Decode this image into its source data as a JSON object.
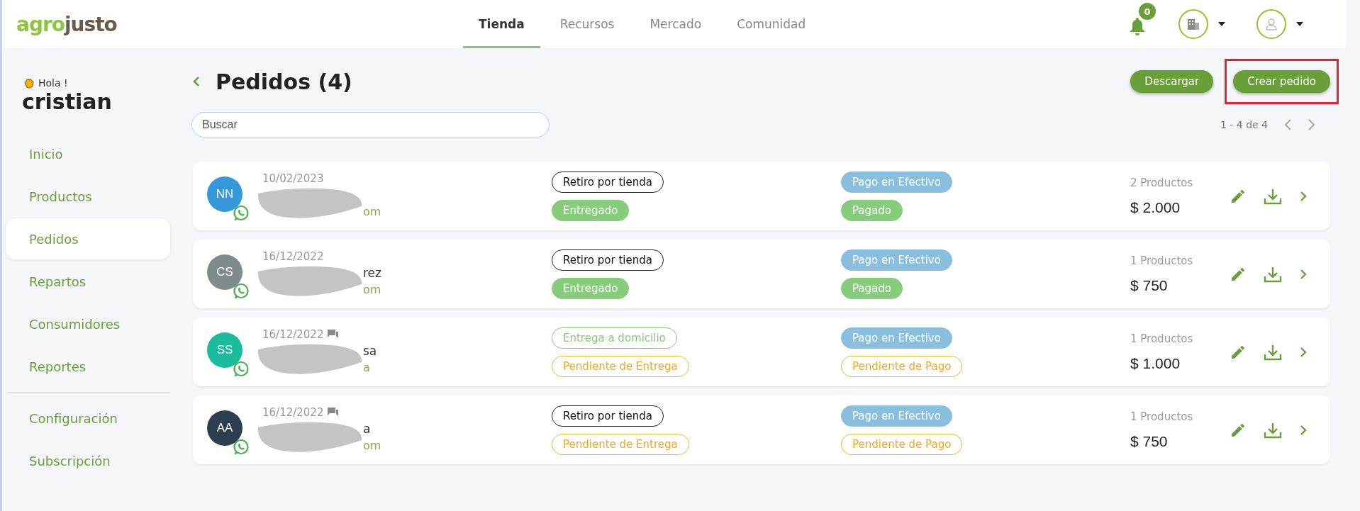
{
  "brand": {
    "part1": "agro",
    "part2": "justo"
  },
  "nav": [
    {
      "label": "Tienda",
      "selected": true
    },
    {
      "label": "Recursos",
      "selected": false
    },
    {
      "label": "Mercado",
      "selected": false
    },
    {
      "label": "Comunidad",
      "selected": false
    }
  ],
  "notifications": {
    "count": "0"
  },
  "sidebar": {
    "greeting": "Hola !",
    "user": "cristian",
    "items": [
      {
        "label": "Inicio",
        "selected": false
      },
      {
        "label": "Productos",
        "selected": false
      },
      {
        "label": "Pedidos",
        "selected": true
      },
      {
        "label": "Repartos",
        "selected": false
      },
      {
        "label": "Consumidores",
        "selected": false
      },
      {
        "label": "Reportes",
        "selected": false
      }
    ],
    "footer_items": [
      {
        "label": "Configuración",
        "selected": false
      },
      {
        "label": "Subscripción",
        "selected": false
      }
    ]
  },
  "page": {
    "title": "Pedidos (4)",
    "search": {
      "placeholder": "Buscar"
    },
    "buttons": [
      {
        "label": "Descargar",
        "highlighted": false
      },
      {
        "label": "Crear pedido",
        "highlighted": true
      }
    ],
    "pagination": "1 - 4 de 4"
  },
  "orders": [
    {
      "initials": "NN",
      "color": "#3498db",
      "date": "10/02/2023",
      "has_comment": false,
      "email_visible": "om",
      "delivery": {
        "label": "Retiro por tienda",
        "kind": "outline-dark"
      },
      "delivery_status": {
        "label": "Entregado",
        "kind": "solid-green"
      },
      "payment": {
        "label": "Pago en Efectivo",
        "kind": "solid-blue"
      },
      "payment_status": {
        "label": "Pagado",
        "kind": "solid-green"
      },
      "products": "2 Productos",
      "total": "$ 2.000"
    },
    {
      "initials": "CS",
      "color": "#7f8c8d",
      "date": "16/12/2022",
      "has_comment": false,
      "name_visible": "rez",
      "email_visible": "om",
      "delivery": {
        "label": "Retiro por tienda",
        "kind": "outline-dark"
      },
      "delivery_status": {
        "label": "Entregado",
        "kind": "solid-green"
      },
      "payment": {
        "label": "Pago en Efectivo",
        "kind": "solid-blue"
      },
      "payment_status": {
        "label": "Pagado",
        "kind": "solid-green"
      },
      "products": "1 Productos",
      "total": "$ 750"
    },
    {
      "initials": "SS",
      "color": "#1abc9c",
      "date": "16/12/2022",
      "has_comment": true,
      "name_visible": "sa",
      "email_visible": "a",
      "delivery": {
        "label": "Entrega a domicilio",
        "kind": "outline-green"
      },
      "delivery_status": {
        "label": "Pendiente de Entrega",
        "kind": "outline-orange"
      },
      "payment": {
        "label": "Pago en Efectivo",
        "kind": "solid-blue"
      },
      "payment_status": {
        "label": "Pendiente de Pago",
        "kind": "outline-orange"
      },
      "products": "1 Productos",
      "total": "$ 1.000"
    },
    {
      "initials": "AA",
      "color": "#2c3e50",
      "date": "16/12/2022",
      "has_comment": true,
      "name_visible": "a",
      "email_visible": "om",
      "delivery": {
        "label": "Retiro por tienda",
        "kind": "outline-dark"
      },
      "delivery_status": {
        "label": "Pendiente de Entrega",
        "kind": "outline-orange"
      },
      "payment": {
        "label": "Pago en Efectivo",
        "kind": "solid-blue"
      },
      "payment_status": {
        "label": "Pendiente de Pago",
        "kind": "outline-orange"
      },
      "products": "1 Productos",
      "total": "$ 750"
    }
  ]
}
